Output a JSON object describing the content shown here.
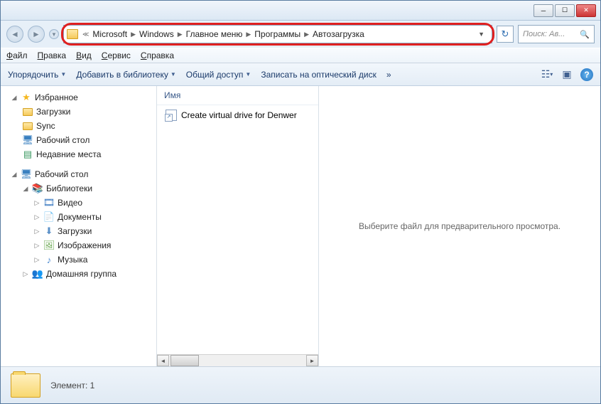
{
  "breadcrumb": {
    "items": [
      "Microsoft",
      "Windows",
      "Главное меню",
      "Программы",
      "Автозагрузка"
    ]
  },
  "search": {
    "placeholder": "Поиск: Ав..."
  },
  "menu": {
    "file": "Файл",
    "edit": "Правка",
    "view": "Вид",
    "tools": "Сервис",
    "help": "Справка"
  },
  "toolbar": {
    "organize": "Упорядочить",
    "library": "Добавить в библиотеку",
    "share": "Общий доступ",
    "burn": "Записать на оптический диск",
    "more": "»"
  },
  "sidebar": {
    "favorites": "Избранное",
    "downloads": "Загрузки",
    "sync": "Sync",
    "desktop": "Рабочий стол",
    "recent": "Недавние места",
    "desktop2": "Рабочий стол",
    "libraries": "Библиотеки",
    "video": "Видео",
    "documents": "Документы",
    "downloads2": "Загрузки",
    "images": "Изображения",
    "music": "Музыка",
    "homegroup": "Домашняя группа"
  },
  "fileheader": {
    "name": "Имя"
  },
  "files": {
    "item0": "Create virtual drive for Denwer"
  },
  "preview": {
    "text": "Выберите файл для предварительного просмотра."
  },
  "status": {
    "text": "Элемент: 1"
  }
}
